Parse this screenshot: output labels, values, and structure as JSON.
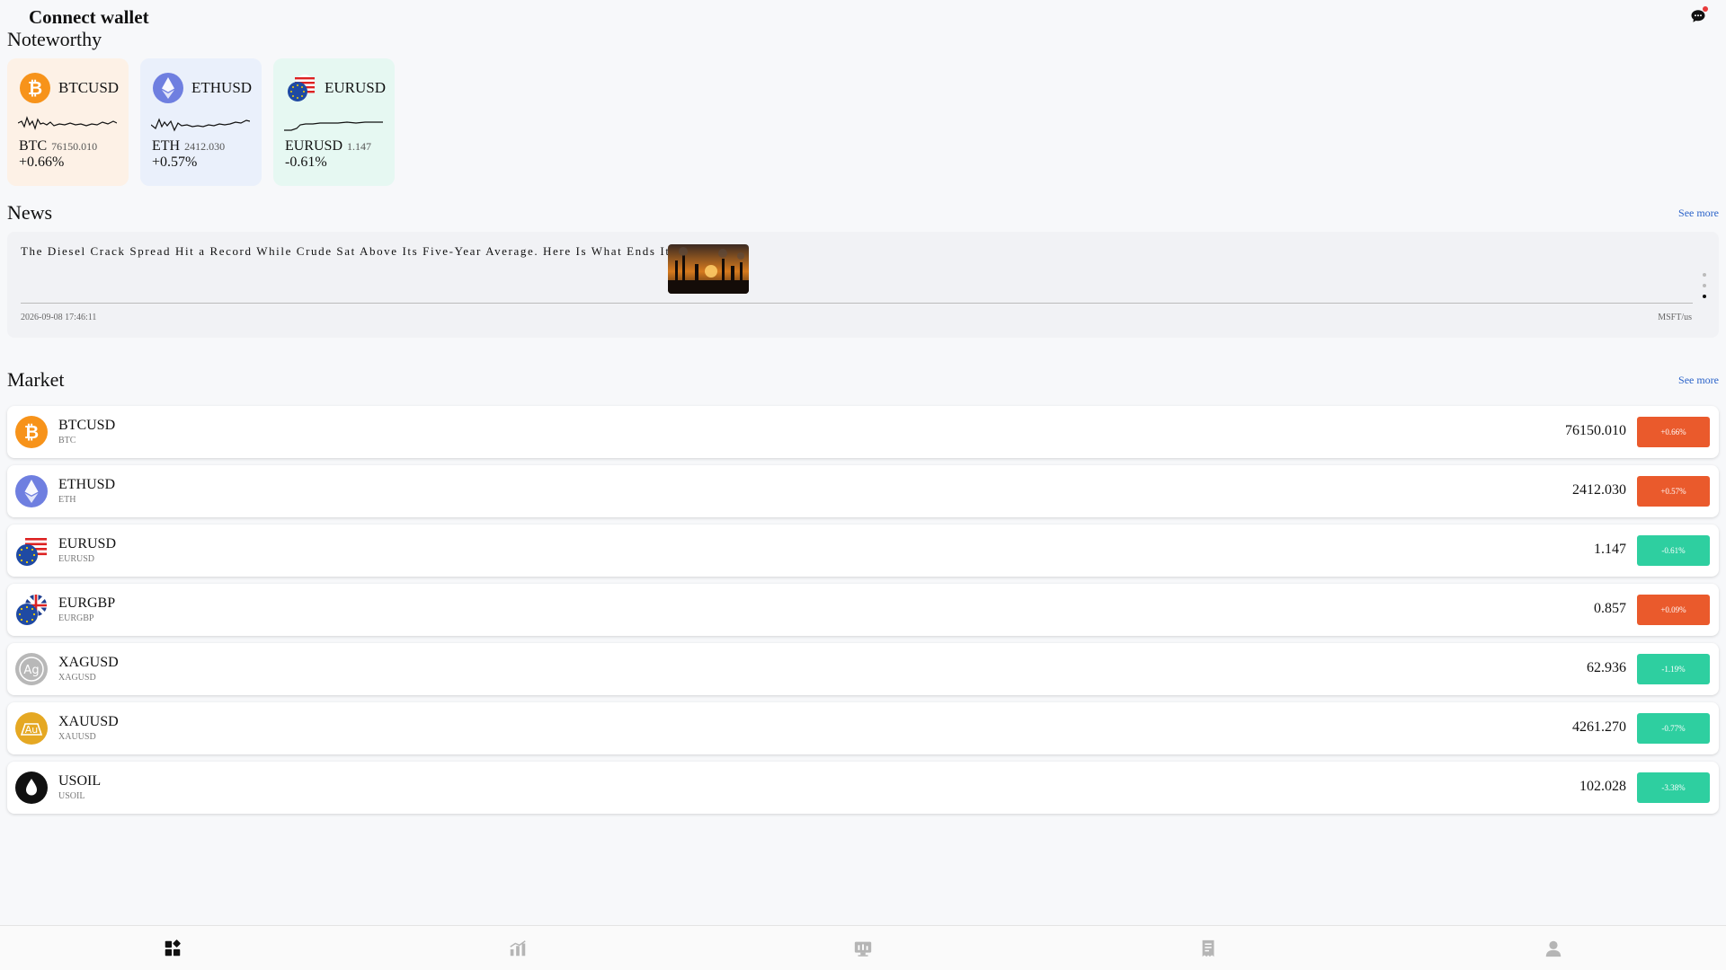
{
  "header": {
    "title": "Connect wallet"
  },
  "sections": {
    "noteworthy": "Noteworthy",
    "news": "News",
    "market": "Market",
    "see_more": "See more"
  },
  "noteworthy": [
    {
      "pair": "BTCUSD",
      "symbol": "BTC",
      "price": "76150.010",
      "change": "+0.66%",
      "bg": "#fdf1e6",
      "icon": "bitcoin-icon"
    },
    {
      "pair": "ETHUSD",
      "symbol": "ETH",
      "price": "2412.030",
      "change": "+0.57%",
      "bg": "#eaf0fb",
      "icon": "ethereum-icon"
    },
    {
      "pair": "EURUSD",
      "symbol": "EURUSD",
      "price": "1.147",
      "change": "-0.61%",
      "bg": "#e6f8f2",
      "icon": "eur-usd-flag-icon"
    }
  ],
  "news": {
    "headline": "The Diesel Crack Spread Hit a Record While Crude Sat Above Its Five-Year Average. Here Is What Ends It",
    "date": "2026-09-08 17:46:11",
    "source": "MSFT/us"
  },
  "market": [
    {
      "pair": "BTCUSD",
      "sub": "BTC",
      "price": "76150.010",
      "change": "+0.66%",
      "direction": "up",
      "icon": "bitcoin-icon"
    },
    {
      "pair": "ETHUSD",
      "sub": "ETH",
      "price": "2412.030",
      "change": "+0.57%",
      "direction": "up",
      "icon": "ethereum-icon"
    },
    {
      "pair": "EURUSD",
      "sub": "EURUSD",
      "price": "1.147",
      "change": "-0.61%",
      "direction": "down",
      "icon": "eur-usd-flag-icon"
    },
    {
      "pair": "EURGBP",
      "sub": "EURGBP",
      "price": "0.857",
      "change": "+0.09%",
      "direction": "up",
      "icon": "eur-gbp-flag-icon"
    },
    {
      "pair": "XAGUSD",
      "sub": "XAGUSD",
      "price": "62.936",
      "change": "-1.19%",
      "direction": "down",
      "icon": "silver-icon"
    },
    {
      "pair": "XAUUSD",
      "sub": "XAUUSD",
      "price": "4261.270",
      "change": "-0.77%",
      "direction": "down",
      "icon": "gold-icon"
    },
    {
      "pair": "USOIL",
      "sub": "USOIL",
      "price": "102.028",
      "change": "-3.38%",
      "direction": "down",
      "icon": "oil-drop-icon"
    }
  ],
  "colors": {
    "up": "#ea5a2c",
    "down": "#2ecfa0",
    "link": "#2b63c9"
  },
  "nav": [
    {
      "icon": "dashboard-icon",
      "active": true
    },
    {
      "icon": "chart-icon",
      "active": false
    },
    {
      "icon": "trade-screen-icon",
      "active": false
    },
    {
      "icon": "orders-icon",
      "active": false
    },
    {
      "icon": "profile-icon",
      "active": false
    }
  ]
}
